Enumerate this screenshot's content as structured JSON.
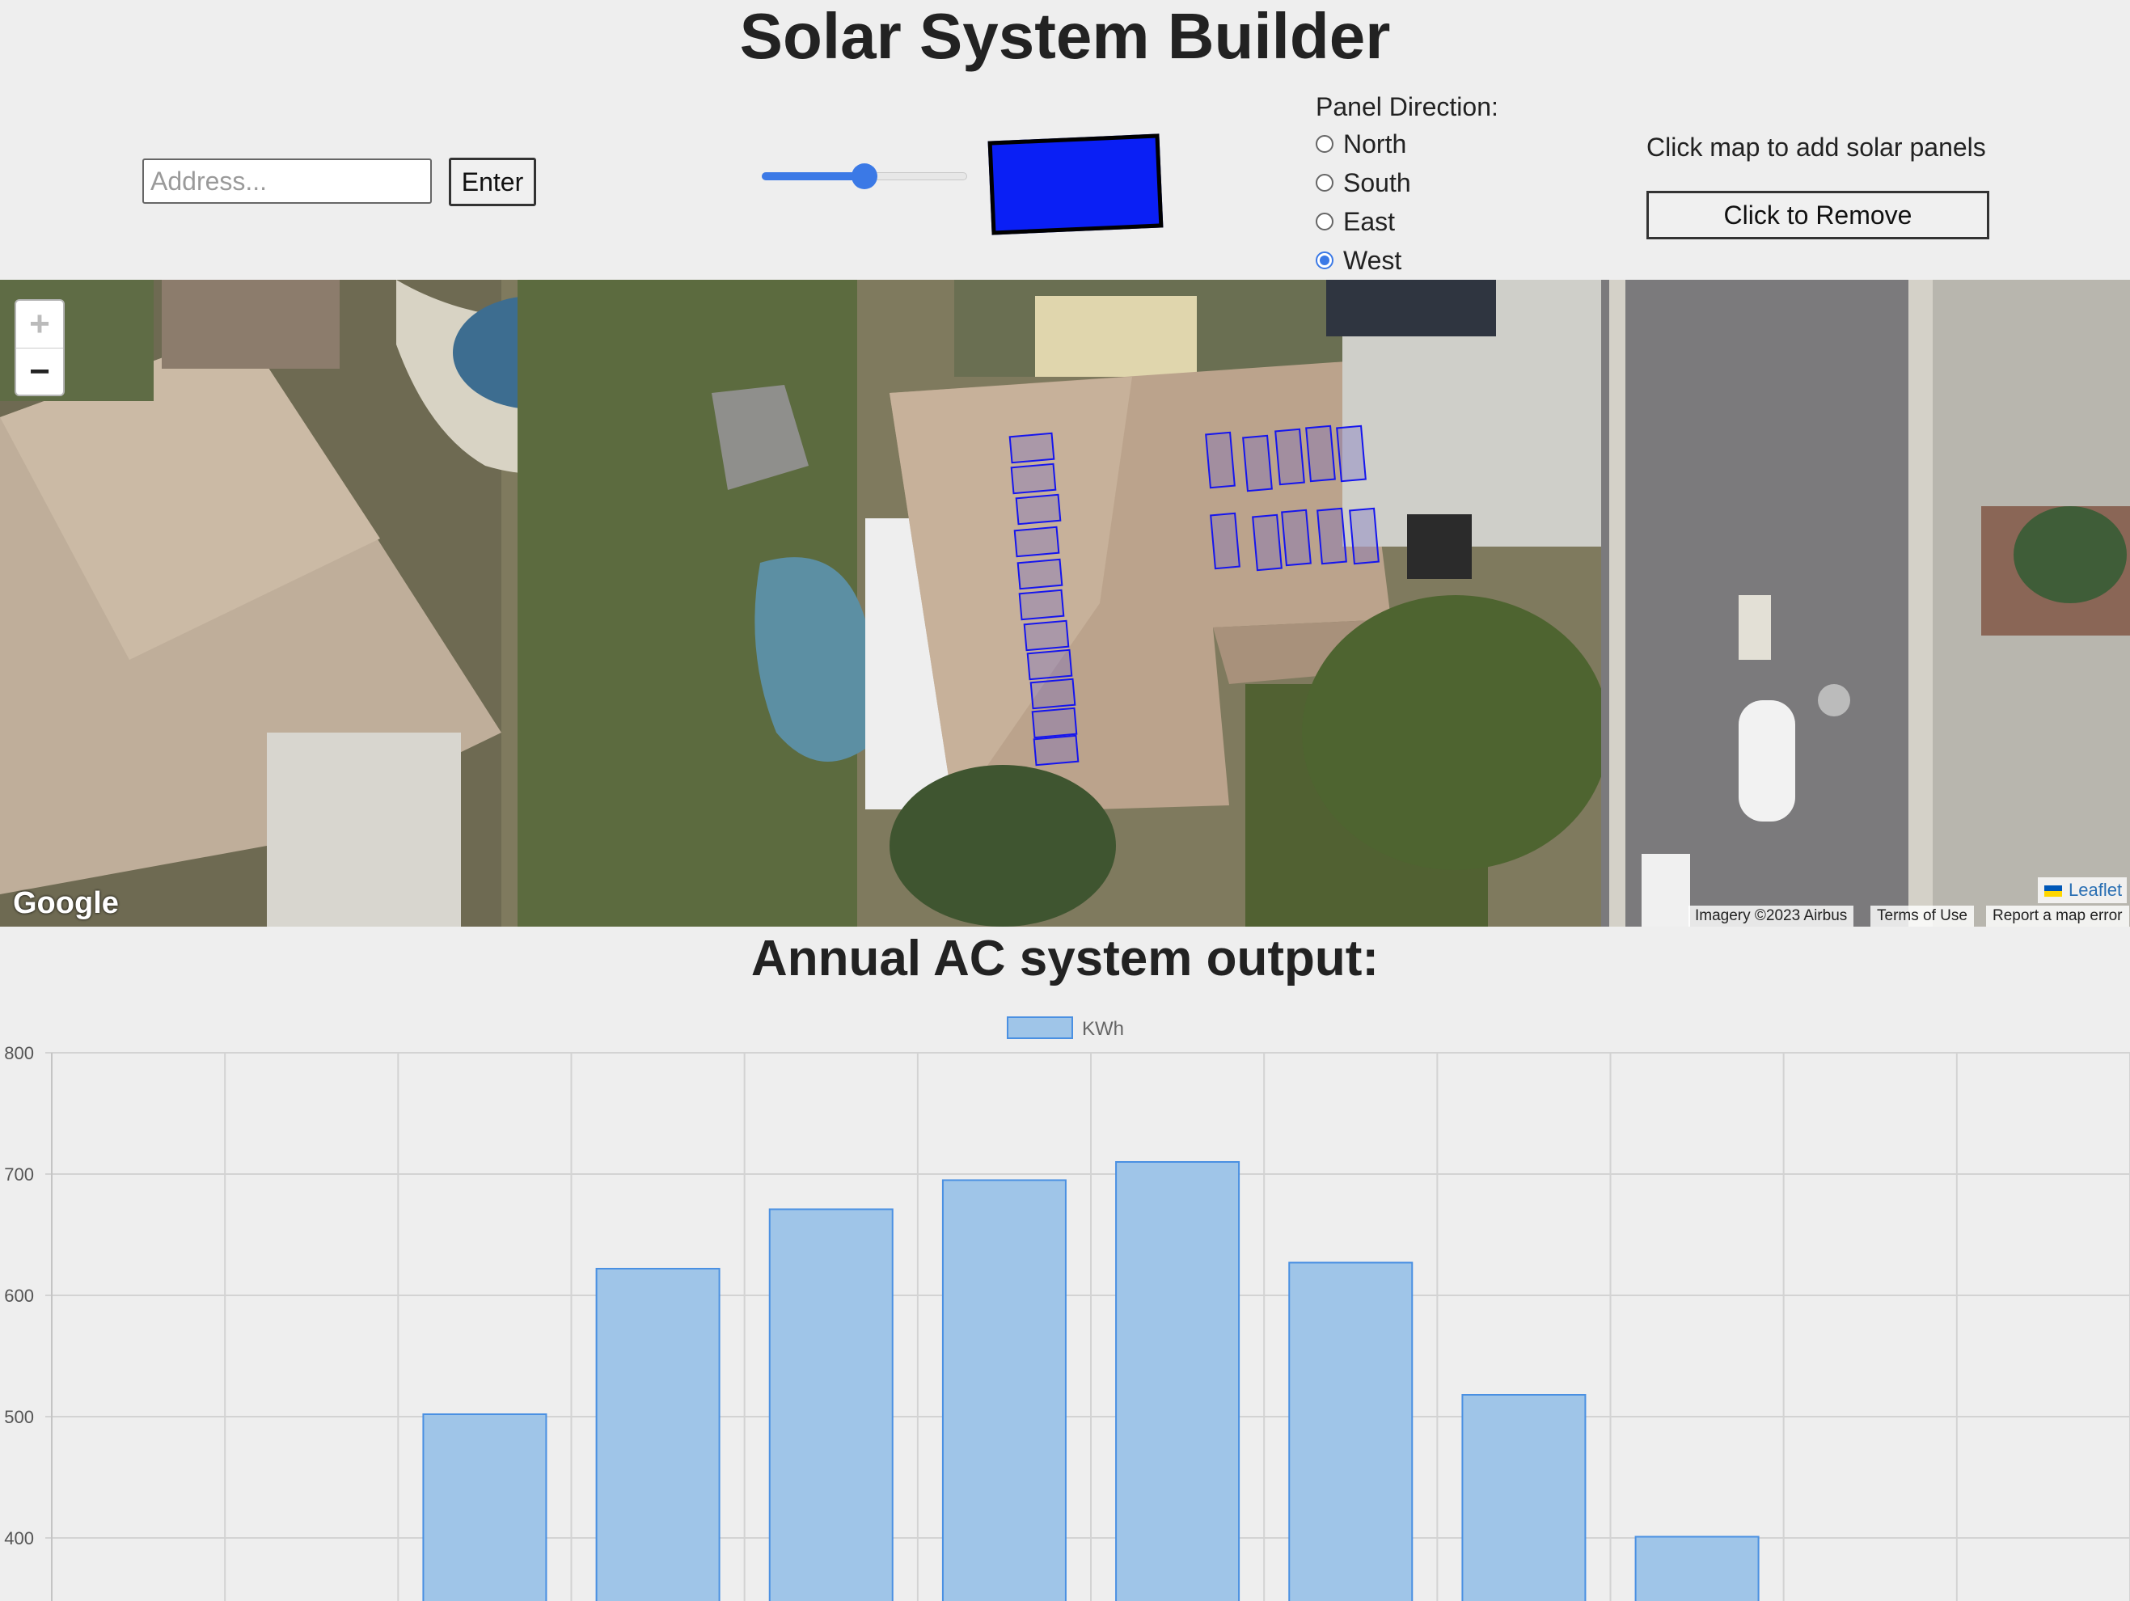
{
  "header": {
    "title": "Solar System Builder"
  },
  "address": {
    "placeholder": "Address...",
    "value": "",
    "button": "Enter"
  },
  "panel_size_slider": {
    "value": 0.5
  },
  "panel_preview": {
    "color": "#0a1ff5",
    "border_color": "#000000"
  },
  "direction": {
    "label": "Panel Direction:",
    "options": [
      "North",
      "South",
      "East",
      "West"
    ],
    "selected": "West"
  },
  "panels": {
    "hint": "Click map to add solar panels",
    "remove_button": "Click to Remove"
  },
  "map": {
    "zoom_in": "+",
    "zoom_out": "−",
    "provider_logo": "Google",
    "attribution": {
      "imagery": "Imagery ©2023 Airbus",
      "terms": "Terms of Use",
      "report": "Report a map error",
      "leaflet": "Leaflet"
    }
  },
  "chart_section": {
    "title": "Annual AC system output:"
  },
  "chart_data": {
    "type": "bar",
    "title": "",
    "legend": {
      "label": "KWh",
      "position": "top"
    },
    "bar_fill": "#9fc5e8",
    "bar_border": "#4a90e2",
    "ylim_visible": [
      350,
      800
    ],
    "yticks": [
      800,
      700,
      600,
      500,
      400
    ],
    "grid": true,
    "series": [
      {
        "name": "KWh",
        "values": [
          null,
          null,
          502,
          622,
          671,
          695,
          710,
          627,
          518,
          401,
          null,
          null
        ]
      }
    ]
  }
}
